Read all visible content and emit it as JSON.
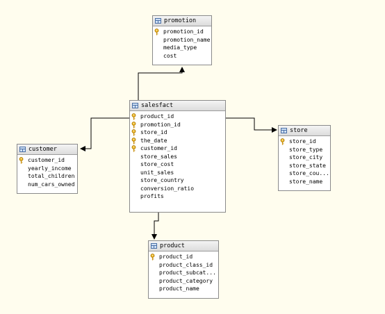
{
  "tables": {
    "promotion": {
      "name": "promotion",
      "columns": [
        {
          "label": "promotion_id",
          "key": true
        },
        {
          "label": "promotion_name",
          "key": false
        },
        {
          "label": "media_type",
          "key": false
        },
        {
          "label": "cost",
          "key": false
        }
      ]
    },
    "salesfact": {
      "name": "salesfact",
      "columns": [
        {
          "label": "product_id",
          "key": true
        },
        {
          "label": "promotion_id",
          "key": true
        },
        {
          "label": "store_id",
          "key": true
        },
        {
          "label": "the_date",
          "key": true
        },
        {
          "label": "customer_id",
          "key": true
        },
        {
          "label": "store_sales",
          "key": false
        },
        {
          "label": "store_cost",
          "key": false
        },
        {
          "label": "unit_sales",
          "key": false
        },
        {
          "label": "store_country",
          "key": false
        },
        {
          "label": "conversion_ratio",
          "key": false
        },
        {
          "label": "profits",
          "key": false
        }
      ]
    },
    "customer": {
      "name": "customer",
      "columns": [
        {
          "label": "customer_id",
          "key": true
        },
        {
          "label": "yearly_income",
          "key": false
        },
        {
          "label": "total_children",
          "key": false
        },
        {
          "label": "num_cars_owned",
          "key": false
        }
      ]
    },
    "store": {
      "name": "store",
      "columns": [
        {
          "label": "store_id",
          "key": true
        },
        {
          "label": "store_type",
          "key": false
        },
        {
          "label": "store_city",
          "key": false
        },
        {
          "label": "store_state",
          "key": false
        },
        {
          "label": "store_cou...",
          "key": false
        },
        {
          "label": "store_name",
          "key": false
        }
      ]
    },
    "product": {
      "name": "product",
      "columns": [
        {
          "label": "product_id",
          "key": true
        },
        {
          "label": "product_class_id",
          "key": false
        },
        {
          "label": "product_subcat...",
          "key": false
        },
        {
          "label": "product_category",
          "key": false
        },
        {
          "label": "product_name",
          "key": false
        }
      ]
    }
  },
  "relationships": [
    {
      "from": "salesfact",
      "to": "promotion"
    },
    {
      "from": "salesfact",
      "to": "customer"
    },
    {
      "from": "salesfact",
      "to": "store"
    },
    {
      "from": "salesfact",
      "to": "product"
    }
  ],
  "colors": {
    "background": "#fffdee",
    "border": "#8a8a8a",
    "key": "#e8b020",
    "connector": "#000000"
  }
}
